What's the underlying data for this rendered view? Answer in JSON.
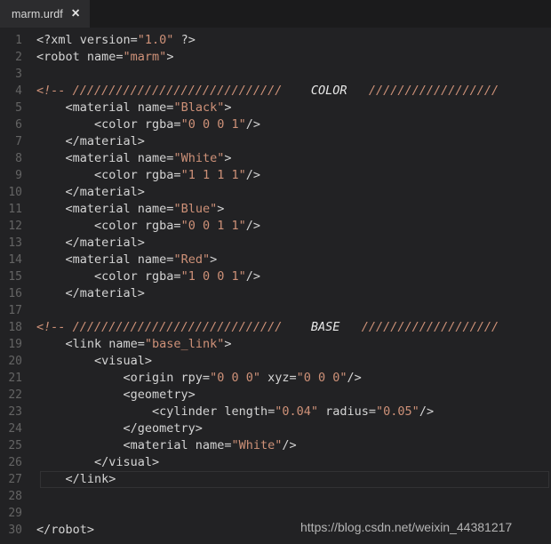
{
  "window": {
    "background": "#222224",
    "tabbar_background": "#1b1b1c"
  },
  "tabbar": {
    "tabs": [
      {
        "label": "marm.urdf",
        "close_label": "✕",
        "active": true
      }
    ]
  },
  "editor": {
    "language": "xml",
    "active_line": 27,
    "first_visible_line": 1,
    "last_visible_line": 30,
    "colors": {
      "background": "#222224",
      "gutter_text": "#646464",
      "default_text": "#d4d4d4",
      "string": "#ce9178",
      "comment": "#ce9178",
      "comment_keyword": "#e8e8e8",
      "active_line_border": "#323234"
    },
    "lines": [
      {
        "n": 1,
        "text": "<?xml version=\"1.0\" ?>"
      },
      {
        "n": 2,
        "text": "<robot name=\"marm\">"
      },
      {
        "n": 3,
        "text": ""
      },
      {
        "n": 4,
        "text": "<!-- /////////////////////////////    COLOR   //////////////////"
      },
      {
        "n": 5,
        "text": "    <material name=\"Black\">"
      },
      {
        "n": 6,
        "text": "        <color rgba=\"0 0 0 1\"/>"
      },
      {
        "n": 7,
        "text": "    </material>"
      },
      {
        "n": 8,
        "text": "    <material name=\"White\">"
      },
      {
        "n": 9,
        "text": "        <color rgba=\"1 1 1 1\"/>"
      },
      {
        "n": 10,
        "text": "    </material>"
      },
      {
        "n": 11,
        "text": "    <material name=\"Blue\">"
      },
      {
        "n": 12,
        "text": "        <color rgba=\"0 0 1 1\"/>"
      },
      {
        "n": 13,
        "text": "    </material>"
      },
      {
        "n": 14,
        "text": "    <material name=\"Red\">"
      },
      {
        "n": 15,
        "text": "        <color rgba=\"1 0 0 1\"/>"
      },
      {
        "n": 16,
        "text": "    </material>"
      },
      {
        "n": 17,
        "text": ""
      },
      {
        "n": 18,
        "text": "<!-- /////////////////////////////    BASE   ///////////////////"
      },
      {
        "n": 19,
        "text": "    <link name=\"base_link\">"
      },
      {
        "n": 20,
        "text": "        <visual>"
      },
      {
        "n": 21,
        "text": "            <origin rpy=\"0 0 0\" xyz=\"0 0 0\"/>"
      },
      {
        "n": 22,
        "text": "            <geometry>"
      },
      {
        "n": 23,
        "text": "                <cylinder length=\"0.04\" radius=\"0.05\"/>"
      },
      {
        "n": 24,
        "text": "            </geometry>"
      },
      {
        "n": 25,
        "text": "            <material name=\"White\"/>"
      },
      {
        "n": 26,
        "text": "        </visual>"
      },
      {
        "n": 27,
        "text": "    </link>"
      },
      {
        "n": 28,
        "text": ""
      },
      {
        "n": 29,
        "text": ""
      },
      {
        "n": 30,
        "text": "</robot>"
      }
    ]
  },
  "watermark": {
    "text": "https://blog.csdn.net/weixin_44381217"
  }
}
